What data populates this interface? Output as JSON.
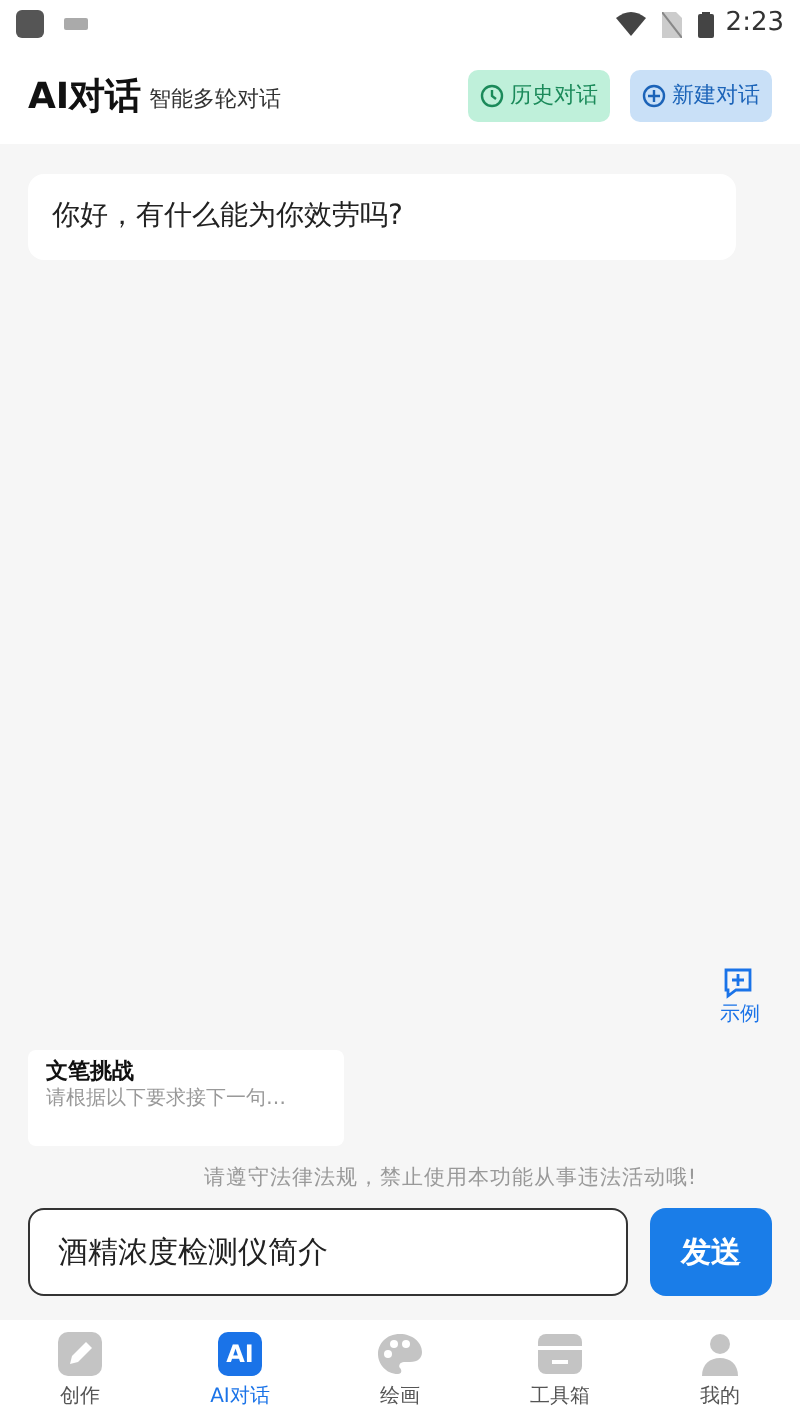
{
  "status_bar": {
    "time": "2:23"
  },
  "header": {
    "title": "AI对话",
    "subtitle": "智能多轮对话",
    "buttons": [
      {
        "label": "历史对话",
        "kind": "history"
      },
      {
        "label": "新建对话",
        "kind": "new"
      }
    ]
  },
  "messages": [
    {
      "text": "你好，有什么能为你效劳吗?"
    }
  ],
  "example_button": {
    "label": "示例"
  },
  "suggestion": {
    "title": "文笔挑战",
    "text": "请根据以下要求接下一句…"
  },
  "notice": "请遵守法律法规，禁止使用本功能从事违法活动哦!",
  "input": {
    "value": "酒精浓度检测仪简介"
  },
  "send_button": {
    "label": "发送"
  },
  "tabs": [
    {
      "label": "创作",
      "kind": "pen",
      "selected": false
    },
    {
      "label": "AI对话",
      "kind": "ai",
      "icon_text": "AI",
      "selected": true
    },
    {
      "label": "绘画",
      "kind": "palette",
      "selected": false
    },
    {
      "label": "工具箱",
      "kind": "toolbox",
      "selected": false
    },
    {
      "label": "我的",
      "kind": "person",
      "selected": false
    }
  ]
}
